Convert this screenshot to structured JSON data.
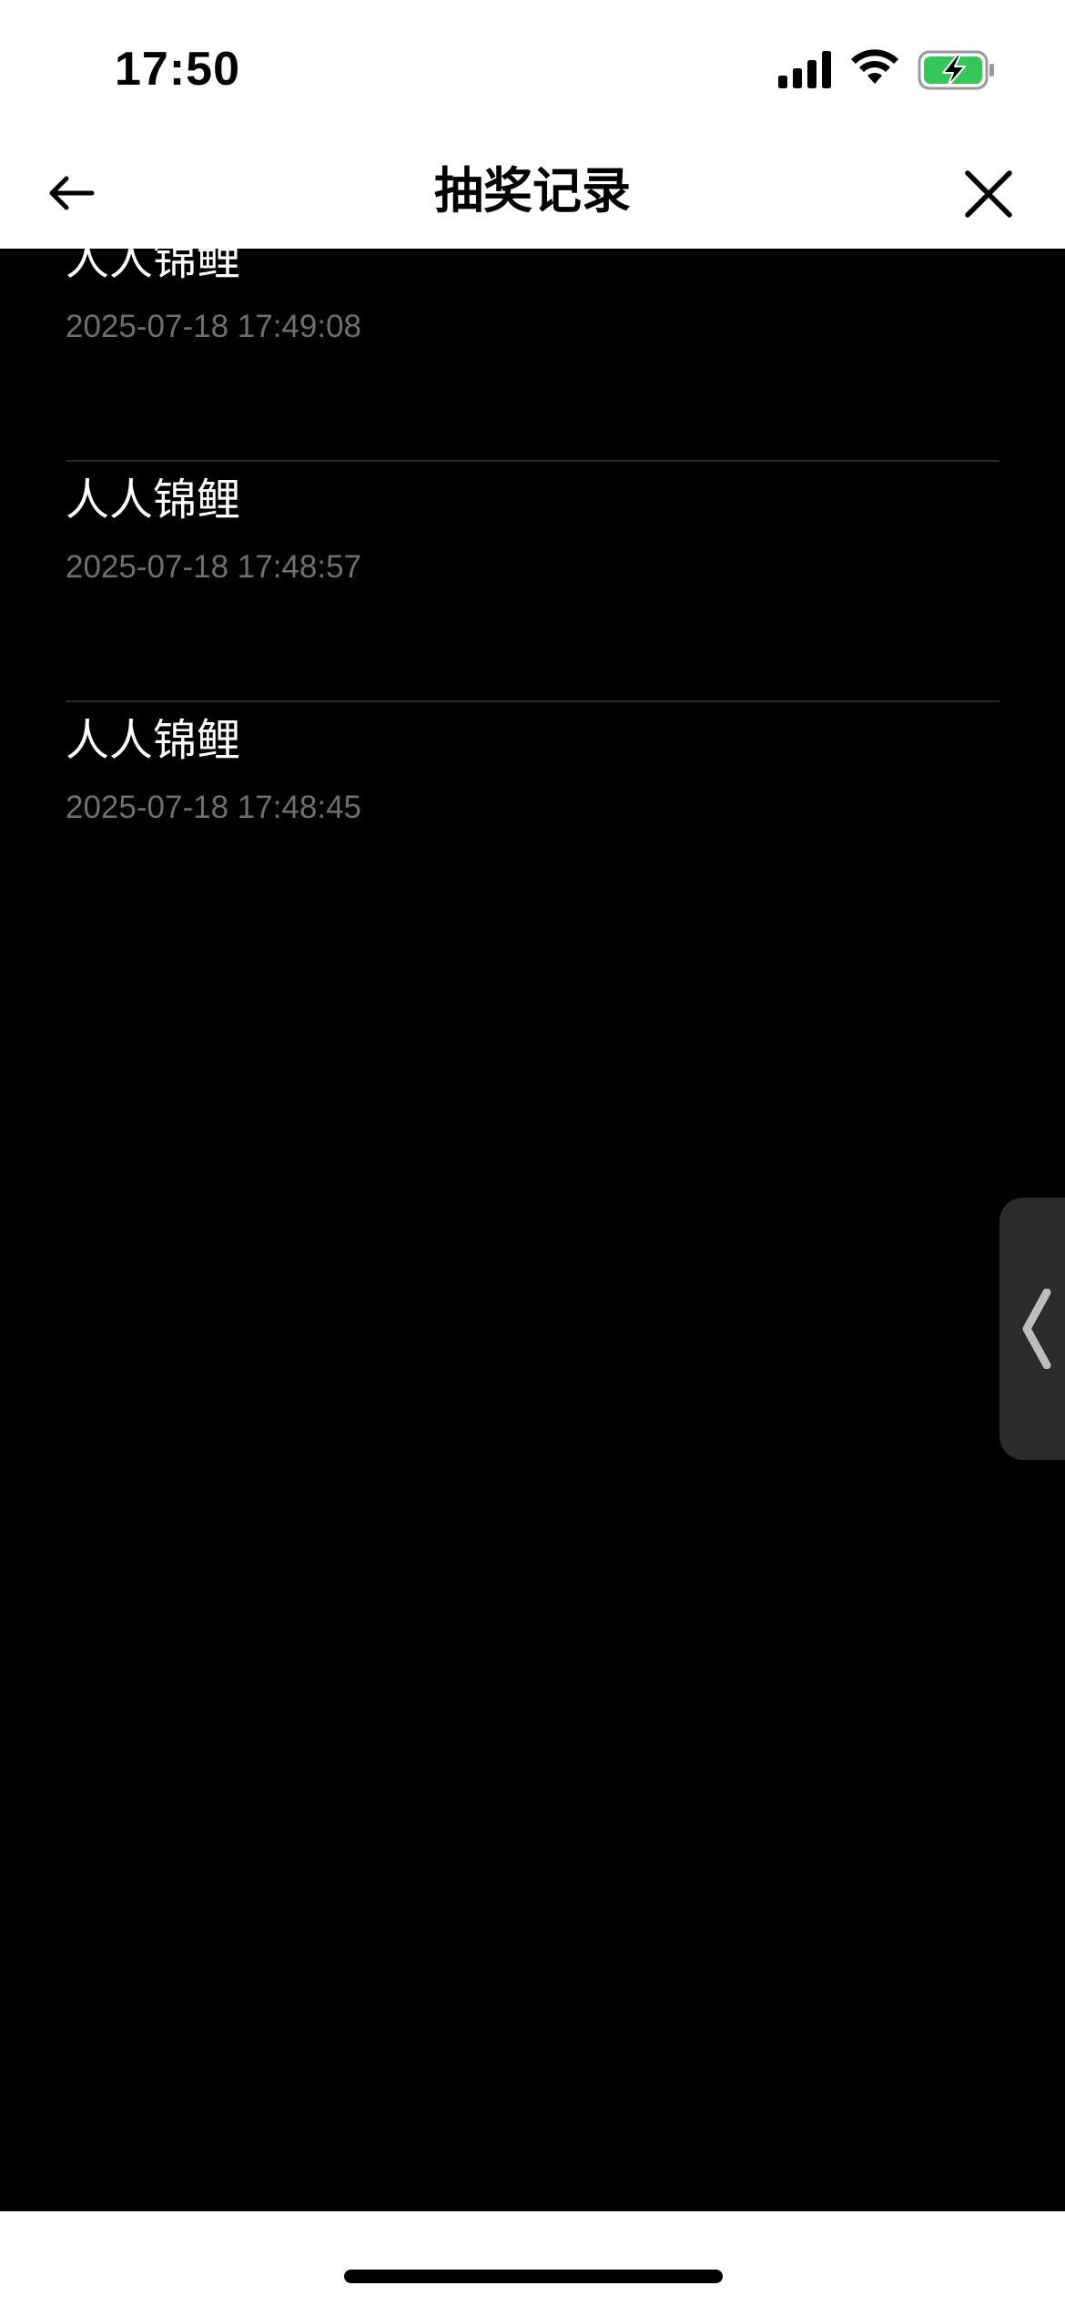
{
  "status_bar": {
    "time": "17:50",
    "icons": [
      "signal-icon",
      "wifi-icon",
      "battery-charging-icon"
    ],
    "battery_color": "#34c759"
  },
  "nav": {
    "title": "抽奖记录",
    "back_icon": "arrow-left-icon",
    "close_icon": "close-icon"
  },
  "records": [
    {
      "title": "人人锦鲤",
      "time": "2025-07-18 17:49:08"
    },
    {
      "title": "人人锦鲤",
      "time": "2025-07-18 17:48:57"
    },
    {
      "title": "人人锦鲤",
      "time": "2025-07-18 17:48:45"
    }
  ],
  "side_handle": {
    "icon": "chevron-left-icon"
  },
  "colors": {
    "background": "#000000",
    "header_background": "#ffffff",
    "title_text": "#ffffff",
    "time_text": "#6e6e6e",
    "divider": "#2a2a2a"
  }
}
